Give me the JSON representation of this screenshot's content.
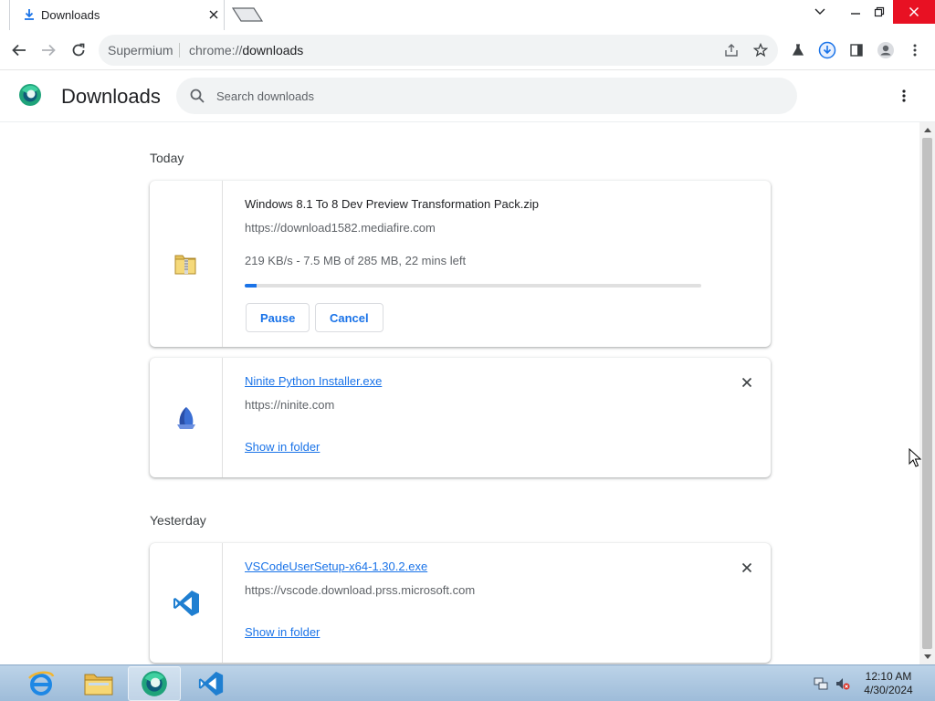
{
  "tab": {
    "title": "Downloads"
  },
  "toolbar": {
    "omnibox_host": "Supermium",
    "omnibox_scheme": "chrome://",
    "omnibox_path": "downloads"
  },
  "header": {
    "title": "Downloads",
    "search_placeholder": "Search downloads"
  },
  "sections": {
    "today": "Today",
    "yesterday": "Yesterday"
  },
  "downloads": [
    {
      "name": "Windows 8.1 To 8 Dev Preview Transformation Pack.zip",
      "url": "https://download1582.mediafire.com",
      "status": "219 KB/s - 7.5 MB of 285 MB, 22 mins left",
      "progress_fraction": 0.026,
      "pause_label": "Pause",
      "cancel_label": "Cancel",
      "icon": "zip-folder-icon"
    },
    {
      "name": "Ninite Python Installer.exe",
      "url": "https://ninite.com",
      "action_label": "Show in folder",
      "icon": "ninite-icon"
    },
    {
      "name": "VSCodeUserSetup-x64-1.30.2.exe",
      "url": "https://vscode.download.prss.microsoft.com",
      "action_label": "Show in folder",
      "icon": "vscode-icon"
    }
  ],
  "taskbar": {
    "time": "12:10 AM",
    "date": "4/30/2024"
  },
  "colors": {
    "accent": "#1a73e8",
    "close_red": "#e81123"
  }
}
